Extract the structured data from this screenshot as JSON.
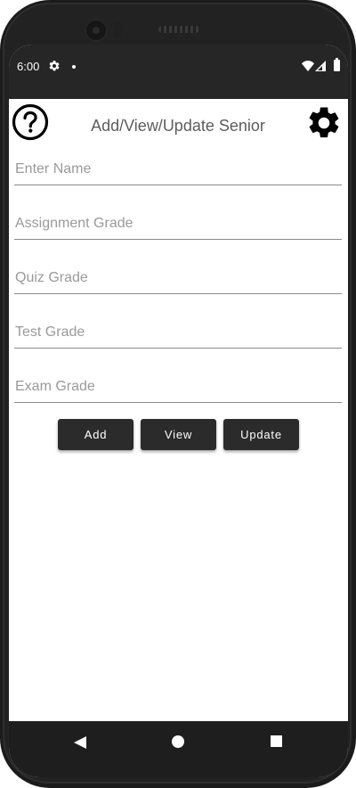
{
  "status_bar": {
    "time": "6:00",
    "icons": [
      "settings-icon",
      "notification-dot",
      "wifi-icon",
      "signal-icon",
      "battery-icon"
    ]
  },
  "header": {
    "title": "Add/View/Update Senior",
    "help_icon": "help-circle-icon",
    "settings_icon": "gear-icon"
  },
  "form": {
    "name_placeholder": "Enter Name",
    "assignment_placeholder": "Assignment Grade",
    "quiz_placeholder": "Quiz Grade",
    "test_placeholder": "Test Grade",
    "exam_placeholder": "Exam Grade"
  },
  "actions": {
    "add_label": "Add",
    "view_label": "View",
    "update_label": "Update"
  },
  "nav_bar": {
    "icons": [
      "back-icon",
      "home-icon",
      "recents-icon"
    ]
  },
  "colors": {
    "button_bg": "#2b2b2b",
    "status_bar_bg": "#262626",
    "title_text": "#5d5d5d",
    "placeholder_text": "#9a9a9a"
  }
}
